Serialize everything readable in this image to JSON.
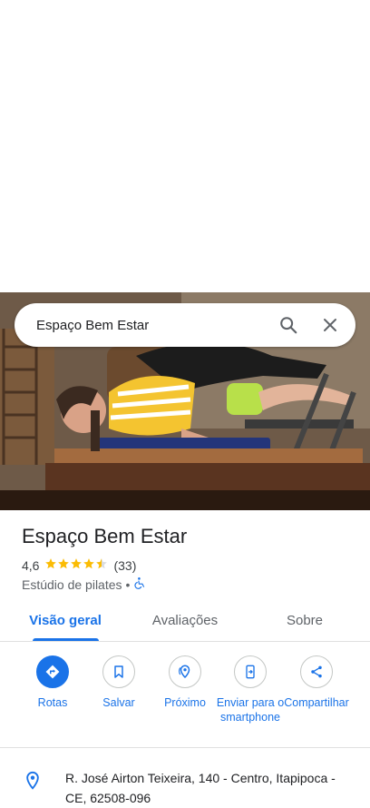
{
  "search": {
    "query": "Espaço Bem Estar"
  },
  "place": {
    "name": "Espaço Bem Estar",
    "rating": "4,6",
    "stars": 4.5,
    "review_count": "(33)",
    "category": "Estúdio de pilates",
    "separator": "•"
  },
  "tabs": [
    {
      "label": "Visão geral",
      "active": true
    },
    {
      "label": "Avaliações",
      "active": false
    },
    {
      "label": "Sobre",
      "active": false
    }
  ],
  "actions": [
    {
      "label": "Rotas",
      "icon": "directions-icon"
    },
    {
      "label": "Salvar",
      "icon": "bookmark-icon"
    },
    {
      "label": "Próximo",
      "icon": "nearby-icon"
    },
    {
      "label": "Enviar para o smartphone",
      "icon": "send-to-phone-icon"
    },
    {
      "label": "Compartilhar",
      "icon": "share-icon"
    }
  ],
  "address": "R. José Airton Teixeira, 140 - Centro, Itapipoca - CE, 62508-096",
  "colors": {
    "accent": "#1a73e8",
    "star": "#fbbc04",
    "text": "#202124",
    "muted": "#5f6368"
  }
}
